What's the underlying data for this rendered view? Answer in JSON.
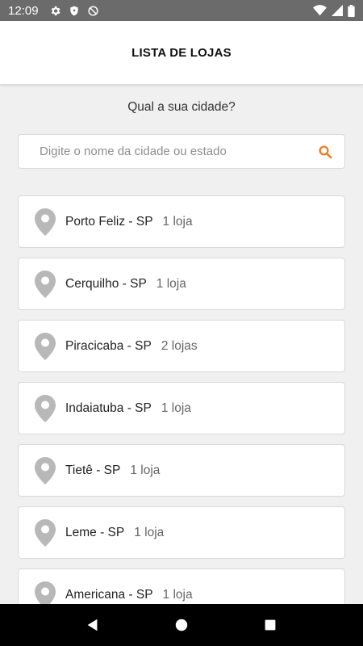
{
  "status_bar": {
    "time": "12:09",
    "icons": [
      "settings-icon",
      "shield-icon",
      "no-sync-icon",
      "wifi-icon",
      "signal-icon",
      "battery-icon"
    ]
  },
  "header": {
    "title": "LISTA DE LOJAS"
  },
  "main": {
    "question": "Qual a sua cidade?",
    "search": {
      "placeholder": "Digite o nome da cidade ou estado",
      "value": ""
    },
    "accent_color": "#f07c1e",
    "stores": [
      {
        "city": "Porto Feliz - SP",
        "count": "1 loja"
      },
      {
        "city": "Cerquilho - SP",
        "count": "1 loja"
      },
      {
        "city": "Piracicaba - SP",
        "count": "2 lojas"
      },
      {
        "city": "Indaiatuba - SP",
        "count": "1 loja"
      },
      {
        "city": "Tietê - SP",
        "count": "1 loja"
      },
      {
        "city": "Leme - SP",
        "count": "1 loja"
      },
      {
        "city": "Americana - SP",
        "count": "1 loja"
      }
    ]
  },
  "nav_bar": {
    "buttons": [
      "back-icon",
      "home-icon",
      "recents-icon"
    ]
  }
}
